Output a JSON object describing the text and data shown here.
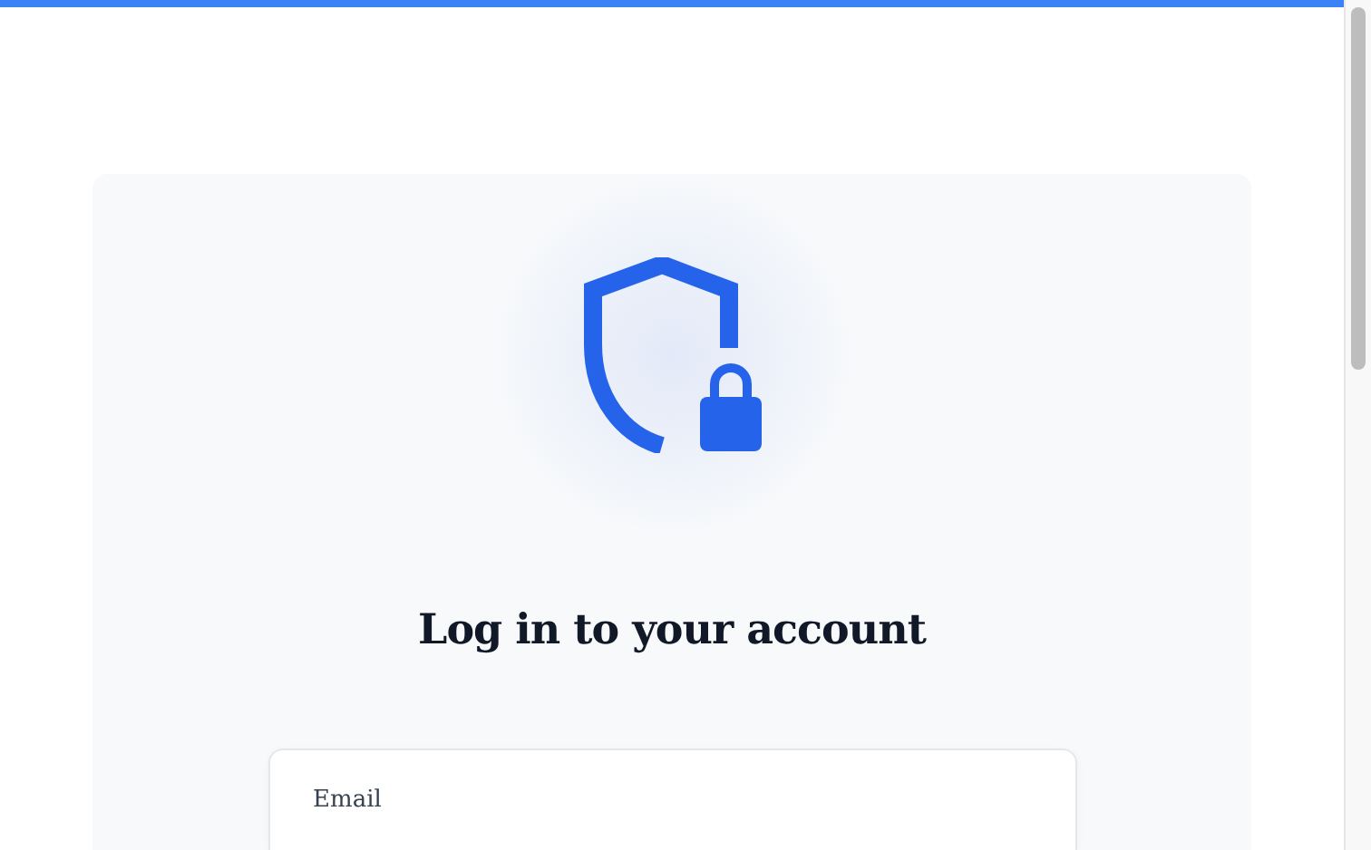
{
  "login": {
    "title": "Log in to your account",
    "form": {
      "email_label": "Email"
    }
  }
}
